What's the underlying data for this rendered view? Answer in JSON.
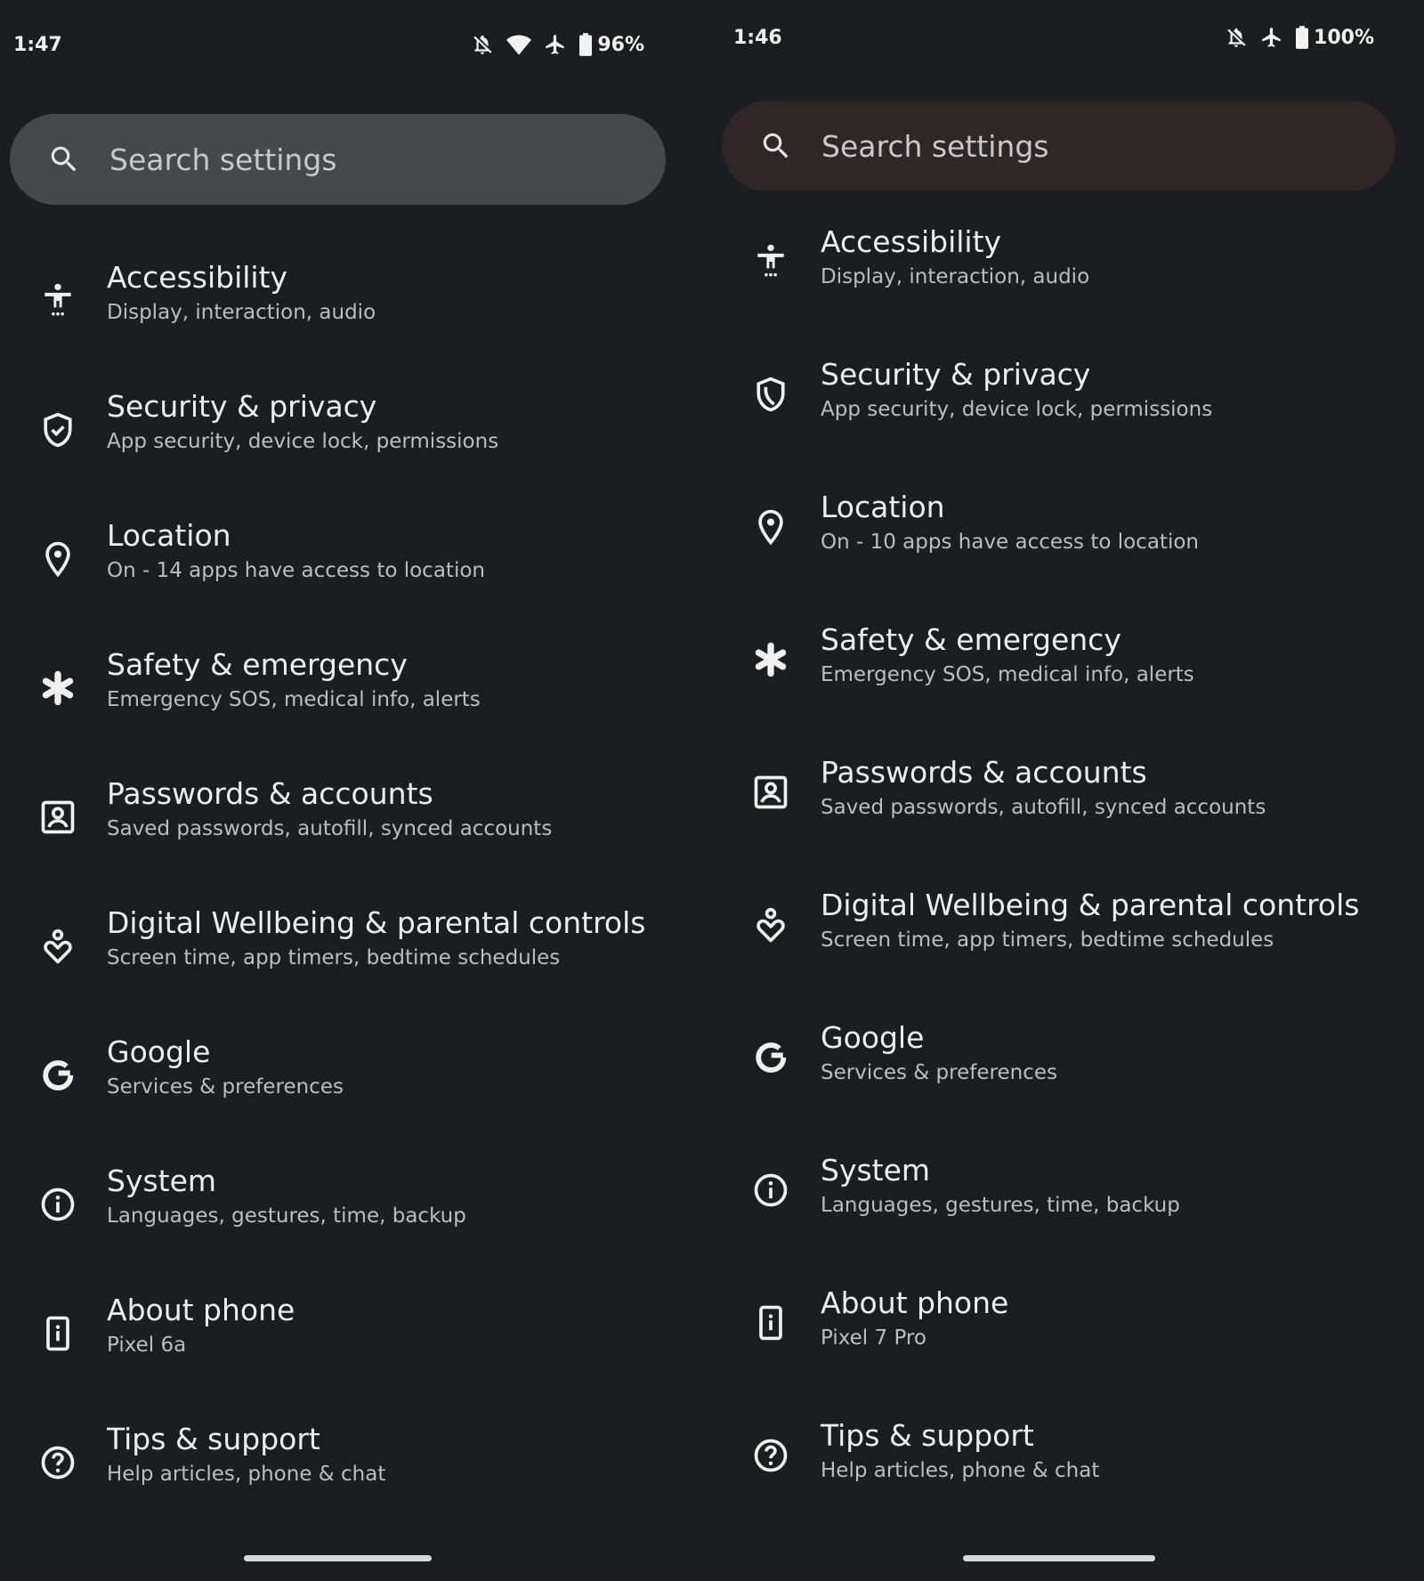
{
  "left": {
    "status": {
      "time": "1:47",
      "battery": "96%",
      "icons": [
        "notifications-off-icon",
        "wifi-icon",
        "airplane-icon",
        "battery-icon"
      ]
    },
    "search": {
      "placeholder": "Search settings",
      "accent": "#45494a"
    },
    "items": [
      {
        "icon": "accessibility-icon",
        "title": "Accessibility",
        "subtitle": "Display, interaction, audio"
      },
      {
        "icon": "shield-check-icon",
        "title": "Security & privacy",
        "subtitle": "App security, device lock, permissions"
      },
      {
        "icon": "location-pin-icon",
        "title": "Location",
        "subtitle": "On - 14 apps have access to location"
      },
      {
        "icon": "asterisk-icon",
        "title": "Safety & emergency",
        "subtitle": "Emergency SOS, medical info, alerts"
      },
      {
        "icon": "account-box-icon",
        "title": "Passwords & accounts",
        "subtitle": "Saved passwords, autofill, synced accounts"
      },
      {
        "icon": "wellbeing-icon",
        "title": "Digital Wellbeing & parental controls",
        "subtitle": "Screen time, app timers, bedtime schedules"
      },
      {
        "icon": "google-icon",
        "title": "Google",
        "subtitle": "Services & preferences"
      },
      {
        "icon": "info-icon",
        "title": "System",
        "subtitle": "Languages, gestures, time, backup"
      },
      {
        "icon": "phone-info-icon",
        "title": "About phone",
        "subtitle": "Pixel 6a"
      },
      {
        "icon": "help-icon",
        "title": "Tips & support",
        "subtitle": "Help articles, phone & chat"
      }
    ]
  },
  "right": {
    "status": {
      "time": "1:46",
      "battery": "100%",
      "icons": [
        "notifications-off-icon",
        "airplane-icon",
        "battery-icon"
      ]
    },
    "search": {
      "placeholder": "Search settings",
      "accent": "#2f2628"
    },
    "items": [
      {
        "icon": "accessibility-icon",
        "title": "Accessibility",
        "subtitle": "Display, interaction, audio"
      },
      {
        "icon": "shield-icon",
        "title": "Security & privacy",
        "subtitle": "App security, device lock, permissions"
      },
      {
        "icon": "location-pin-icon",
        "title": "Location",
        "subtitle": "On - 10 apps have access to location"
      },
      {
        "icon": "asterisk-icon",
        "title": "Safety & emergency",
        "subtitle": "Emergency SOS, medical info, alerts"
      },
      {
        "icon": "account-box-icon",
        "title": "Passwords & accounts",
        "subtitle": "Saved passwords, autofill, synced accounts"
      },
      {
        "icon": "wellbeing-icon",
        "title": "Digital Wellbeing & parental controls",
        "subtitle": "Screen time, app timers, bedtime schedules"
      },
      {
        "icon": "google-icon",
        "title": "Google",
        "subtitle": "Services & preferences"
      },
      {
        "icon": "info-icon",
        "title": "System",
        "subtitle": "Languages, gestures, time, backup"
      },
      {
        "icon": "phone-info-icon",
        "title": "About phone",
        "subtitle": "Pixel 7 Pro"
      },
      {
        "icon": "help-icon",
        "title": "Tips & support",
        "subtitle": "Help articles, phone & chat"
      }
    ]
  }
}
